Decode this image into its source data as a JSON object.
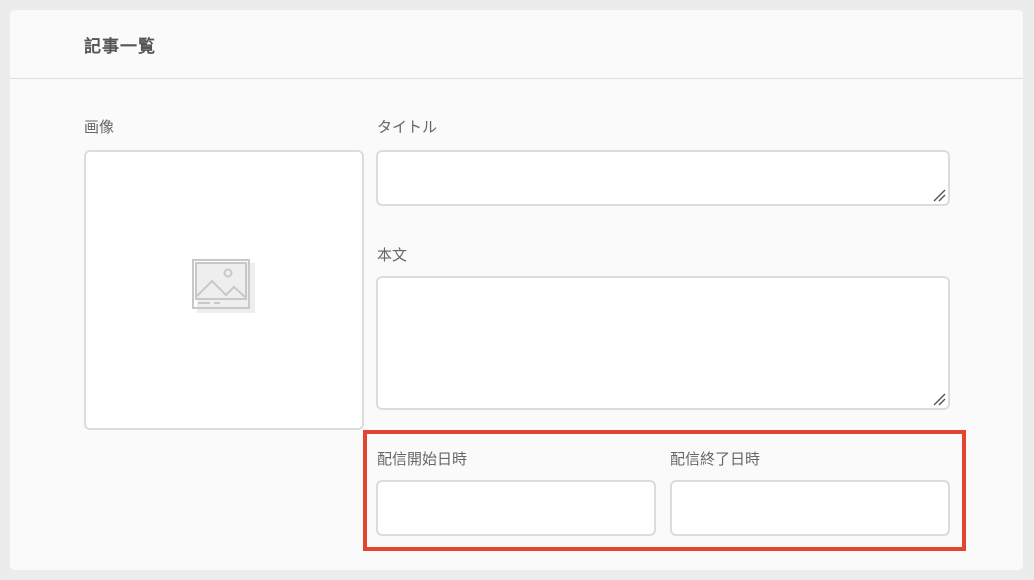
{
  "header": {
    "title": "記事一覧"
  },
  "form": {
    "image": {
      "label": "画像",
      "icon": "image-placeholder-icon"
    },
    "title": {
      "label": "タイトル",
      "value": ""
    },
    "body": {
      "label": "本文",
      "value": ""
    },
    "start": {
      "label": "配信開始日時",
      "value": ""
    },
    "end": {
      "label": "配信終了日時",
      "value": ""
    }
  },
  "colors": {
    "highlight": "#e5452e",
    "border": "#dcdcdc"
  }
}
